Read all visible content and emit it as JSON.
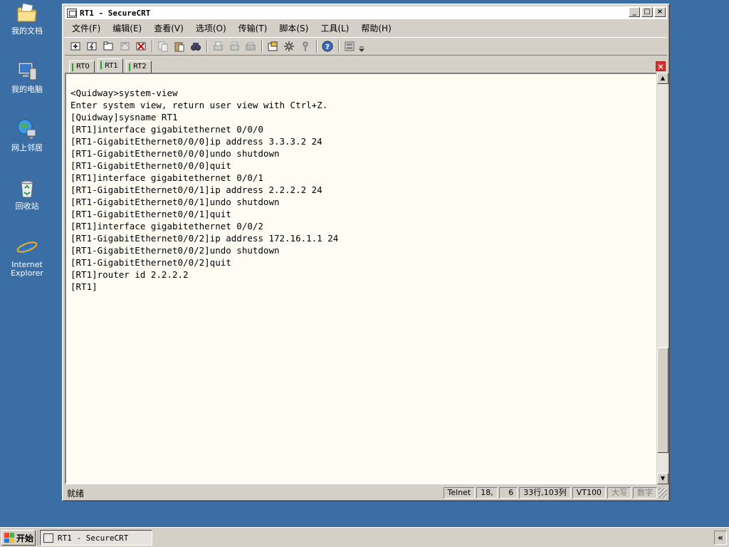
{
  "desktop": {
    "icons": [
      {
        "label": "我的文档",
        "icon": "folder-documents-icon"
      },
      {
        "label": "我的电脑",
        "icon": "computer-icon"
      },
      {
        "label": "网上邻居",
        "icon": "network-icon"
      },
      {
        "label": "回收站",
        "icon": "recycle-bin-icon"
      },
      {
        "label": "Internet Explorer",
        "icon": "internet-explorer-icon"
      }
    ]
  },
  "window": {
    "title": "RT1 - SecureCRT",
    "controls": {
      "minimize": "_",
      "maximize": "□",
      "close": "×"
    }
  },
  "menubar": {
    "items": [
      "文件(F)",
      "编辑(E)",
      "查看(V)",
      "选项(O)",
      "传输(T)",
      "脚本(S)",
      "工具(L)",
      "帮助(H)"
    ]
  },
  "toolbar": {
    "buttons": [
      "connect-icon",
      "quick-connect-icon",
      "connect-tab-icon",
      "reconnect-icon",
      "disconnect-icon",
      "copy-icon",
      "paste-icon",
      "find-icon",
      "print-icon",
      "print-selection-icon",
      "print-setup-icon",
      "session-options-icon",
      "global-options-icon",
      "keymap-icon",
      "help-icon",
      "sftp-icon",
      "more-icon"
    ]
  },
  "tabs": {
    "items": [
      {
        "label": "RT0",
        "active": false
      },
      {
        "label": "RT1",
        "active": true
      },
      {
        "label": "RT2",
        "active": false
      }
    ],
    "close_label": "×"
  },
  "terminal": {
    "lines": [
      "<Quidway>system-view",
      "Enter system view, return user view with Ctrl+Z.",
      "[Quidway]sysname RT1",
      "[RT1]interface gigabitethernet 0/0/0",
      "[RT1-GigabitEthernet0/0/0]ip address 3.3.3.2 24",
      "[RT1-GigabitEthernet0/0/0]undo shutdown",
      "[RT1-GigabitEthernet0/0/0]quit",
      "[RT1]interface gigabitethernet 0/0/1",
      "[RT1-GigabitEthernet0/0/1]ip address 2.2.2.2 24",
      "[RT1-GigabitEthernet0/0/1]undo shutdown",
      "[RT1-GigabitEthernet0/0/1]quit",
      "[RT1]interface gigabitethernet 0/0/2",
      "[RT1-GigabitEthernet0/0/2]ip address 172.16.1.1 24",
      "[RT1-GigabitEthernet0/0/2]undo shutdown",
      "[RT1-GigabitEthernet0/0/2]quit",
      "[RT1]router id 2.2.2.2",
      "[RT1]"
    ],
    "scroll_position": 0.93
  },
  "statusbar": {
    "status": "就绪",
    "protocol": "Telnet",
    "row": "18,",
    "col": "6",
    "size": "33行,103列",
    "emulation": "VT100",
    "caps": "大写",
    "num": "数字"
  },
  "taskbar": {
    "start_label": "开始",
    "task_label": "RT1 - SecureCRT",
    "tray_label": "«"
  },
  "colors": {
    "desktop": "#3a6ea5",
    "terminal_bg": "#fefdf4",
    "tab_marker": "#1eaa1e",
    "tab_close": "#d93030"
  }
}
